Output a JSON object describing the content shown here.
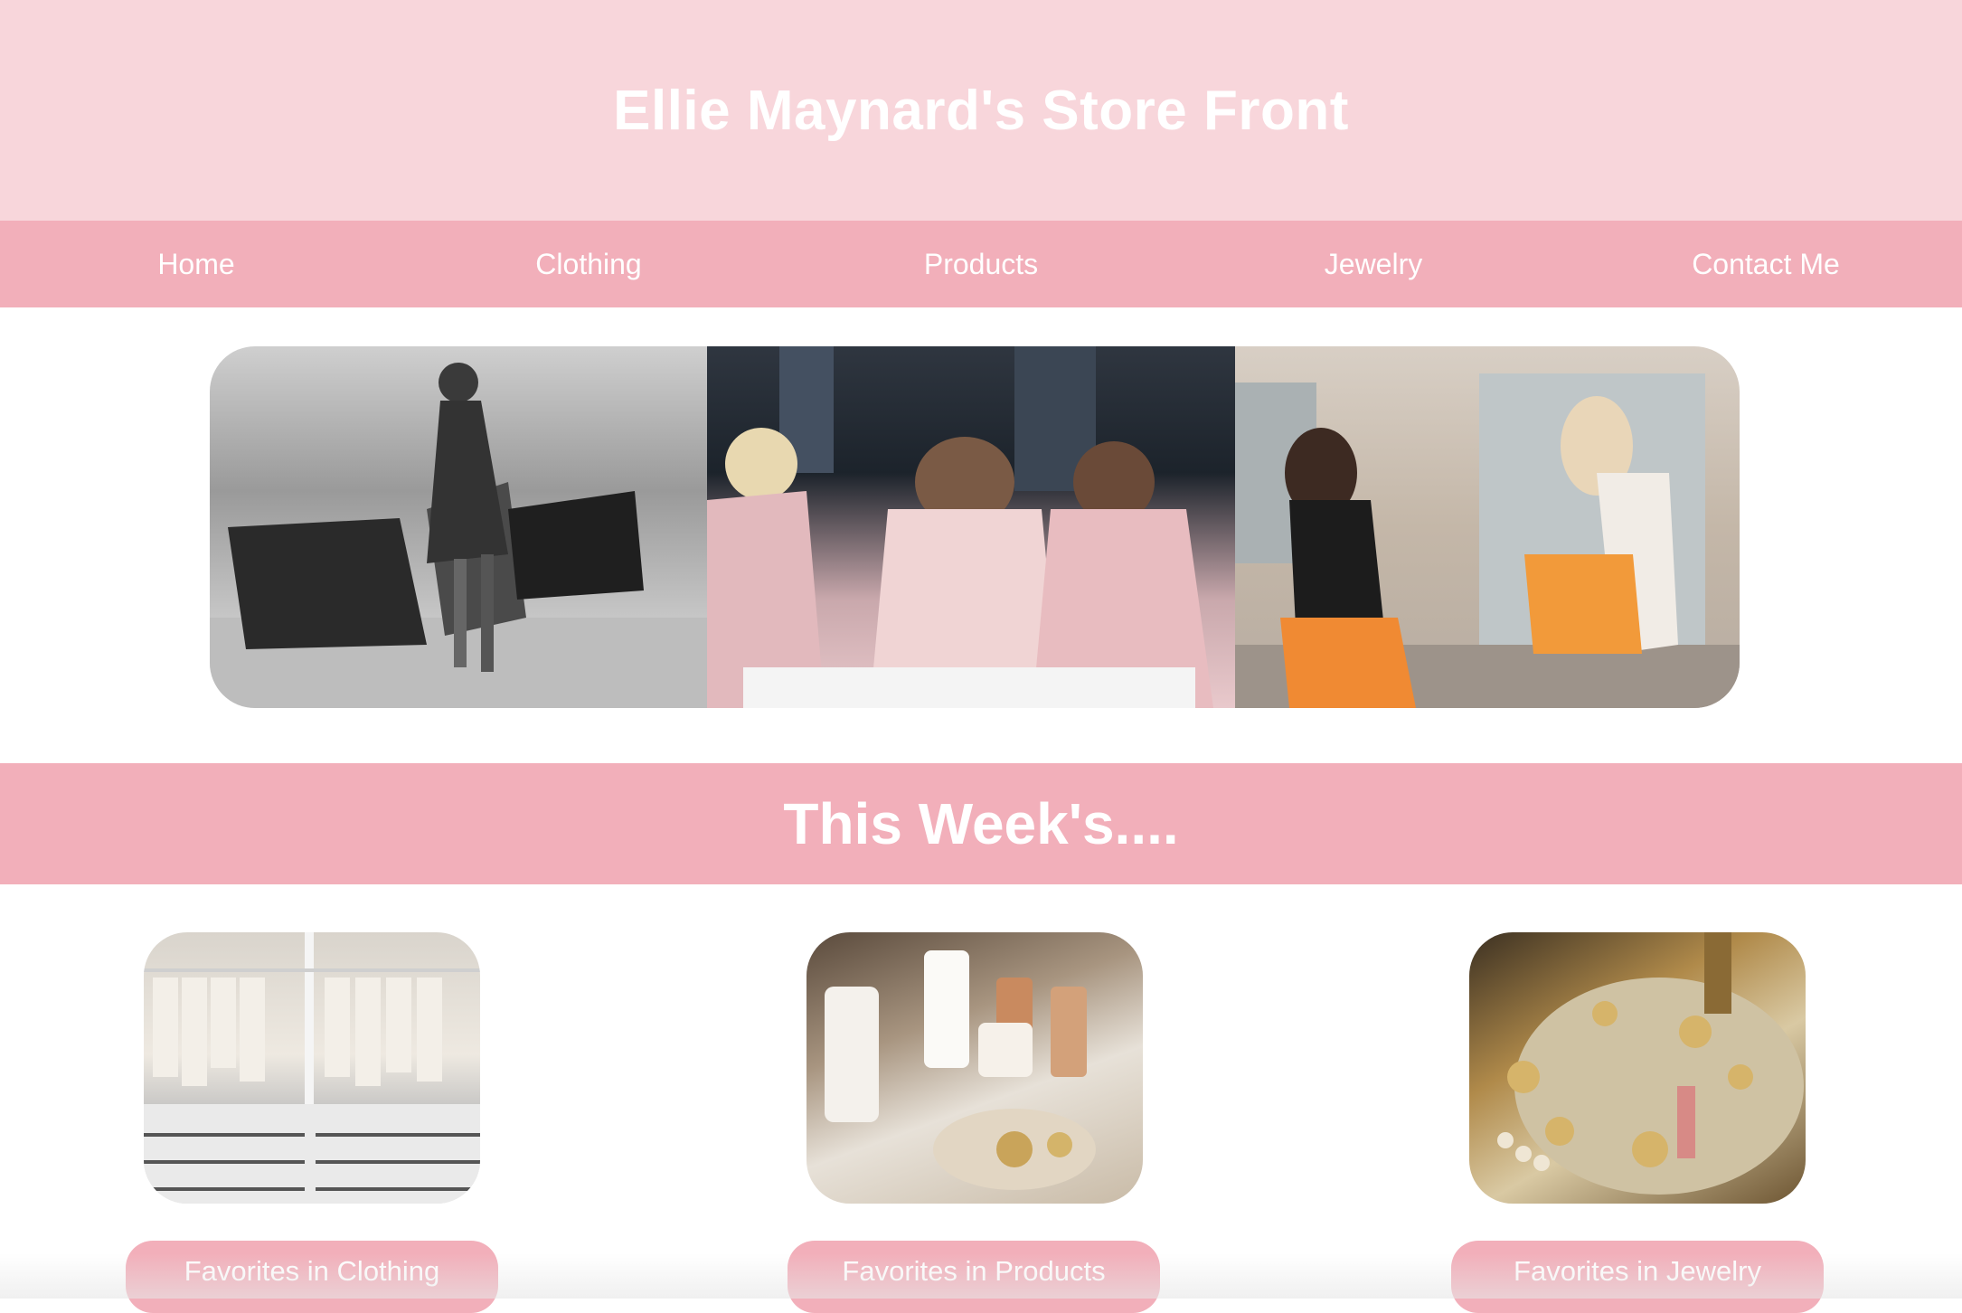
{
  "header": {
    "title": "Ellie Maynard's Store Front"
  },
  "nav": {
    "items": [
      {
        "label": "Home"
      },
      {
        "label": "Clothing"
      },
      {
        "label": "Products"
      },
      {
        "label": "Jewelry"
      },
      {
        "label": "Contact Me"
      }
    ]
  },
  "hero": {
    "images": [
      {
        "name": "hero-photo-shopping-bags"
      },
      {
        "name": "hero-photo-pink-coats"
      },
      {
        "name": "hero-photo-storefront"
      }
    ]
  },
  "section": {
    "title": "This Week's...."
  },
  "cards": [
    {
      "image": "clothing-photo",
      "button_label": "Favorites in Clothing"
    },
    {
      "image": "products-photo",
      "button_label": "Favorites in Products"
    },
    {
      "image": "jewelry-photo",
      "button_label": "Favorites in Jewelry"
    }
  ],
  "colors": {
    "header_bg": "#f8d6db",
    "nav_bg": "#f2afba",
    "text": "#ffffff"
  }
}
